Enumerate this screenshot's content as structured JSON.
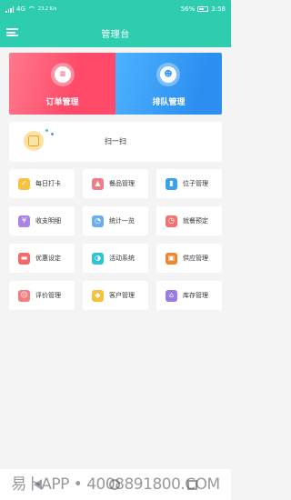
{
  "status_bar": {
    "network": "4G",
    "speed": "23.2 K/s",
    "battery_level": "56%",
    "time": "3:58"
  },
  "header": {
    "title": "管理台"
  },
  "banner": {
    "left_label": "订单管理",
    "right_label": "排队管理"
  },
  "scan": {
    "label": "扫一扫"
  },
  "menu_tiles": [
    {
      "label": "每日打卡",
      "icon": "calendar-check-icon",
      "color": "#f5c242",
      "glyph": "✓"
    },
    {
      "label": "餐品管理",
      "icon": "food-cloche-icon",
      "color": "#f27c86",
      "glyph": "▲"
    },
    {
      "label": "位子管理",
      "icon": "book-icon",
      "color": "#38a3e8",
      "glyph": "▮"
    },
    {
      "label": "收支明细",
      "icon": "receipt-icon",
      "color": "#a983e6",
      "glyph": "¥"
    },
    {
      "label": "统计一览",
      "icon": "pie-chart-icon",
      "color": "#6aaef0",
      "glyph": "◔"
    },
    {
      "label": "就餐预定",
      "icon": "alarm-clock-icon",
      "color": "#f2726e",
      "glyph": "◷"
    },
    {
      "label": "优惠设定",
      "icon": "coupon-icon",
      "color": "#f26a6a",
      "glyph": "▬"
    },
    {
      "label": "活动系统",
      "icon": "activity-icon",
      "color": "#2fc3d6",
      "glyph": "◑"
    },
    {
      "label": "供应管理",
      "icon": "supply-box-icon",
      "color": "#f0862e",
      "glyph": "▣"
    },
    {
      "label": "评价管理",
      "icon": "sad-face-icon",
      "color": "#f27f7f",
      "glyph": "☹"
    },
    {
      "label": "客户管理",
      "icon": "diamond-icon",
      "color": "#f5c23a",
      "glyph": "◆"
    },
    {
      "label": "库存管理",
      "icon": "warehouse-icon",
      "color": "#9b7de0",
      "glyph": "⌂"
    }
  ],
  "watermark": "易卜APP • 4008891800.COM",
  "colors": {
    "header": "#2ecdb0",
    "banner_left": "#ff4a6a",
    "banner_right": "#2b8ef0"
  }
}
